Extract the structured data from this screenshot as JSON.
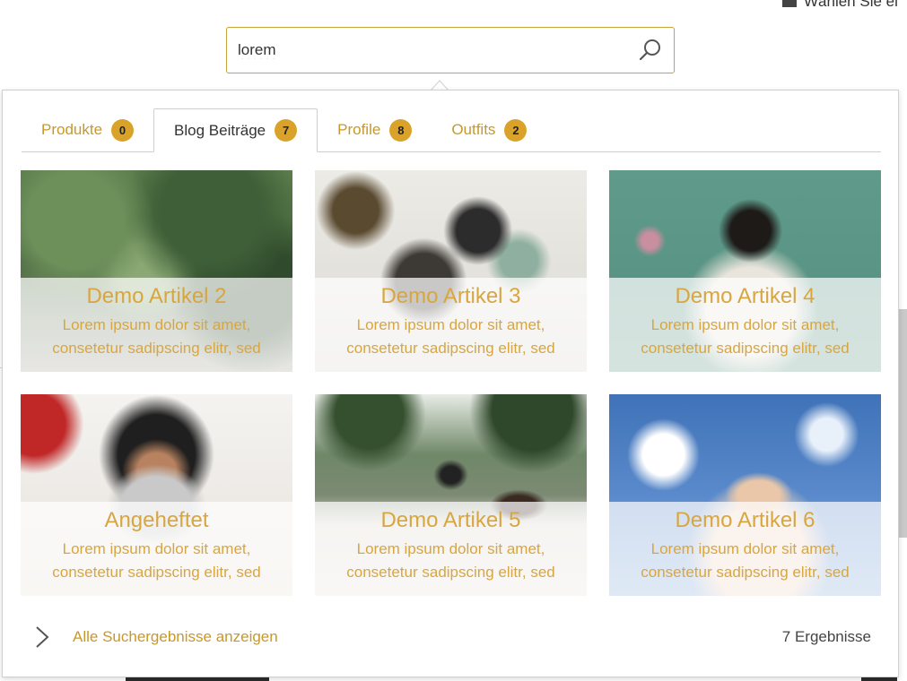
{
  "search": {
    "value": "lorem"
  },
  "background": {
    "top_right_text": "Wählen Sie ei"
  },
  "tabs": [
    {
      "label": "Produkte",
      "count": "0"
    },
    {
      "label": "Blog Beiträge",
      "count": "7",
      "active": true
    },
    {
      "label": "Profile",
      "count": "8"
    },
    {
      "label": "Outfits",
      "count": "2"
    }
  ],
  "results": [
    {
      "title": "Demo Artikel 2",
      "text": "Lorem ipsum dolor sit amet, consetetur sadipscing elitr, sed"
    },
    {
      "title": "Demo Artikel 3",
      "text": "Lorem ipsum dolor sit amet, consetetur sadipscing elitr, sed"
    },
    {
      "title": "Demo Artikel 4",
      "text": "Lorem ipsum dolor sit amet, consetetur sadipscing elitr, sed"
    },
    {
      "title": "Angeheftet",
      "text": "Lorem ipsum dolor sit amet, consetetur sadipscing elitr, sed"
    },
    {
      "title": "Demo Artikel 5",
      "text": "Lorem ipsum dolor sit amet, consetetur sadipscing elitr, sed"
    },
    {
      "title": "Demo Artikel 6",
      "text": "Lorem ipsum dolor sit amet, consetetur sadipscing elitr, sed"
    }
  ],
  "footer": {
    "all_results_label": "Alle Suchergebnisse anzeigen",
    "result_count": "7 Ergebnisse"
  },
  "colors": {
    "accent": "#c8982a",
    "badge": "#d9a22b",
    "border_focus": "#c8a33a"
  },
  "icons": {
    "search": "search-icon",
    "chevron": "chevron-right-icon"
  }
}
